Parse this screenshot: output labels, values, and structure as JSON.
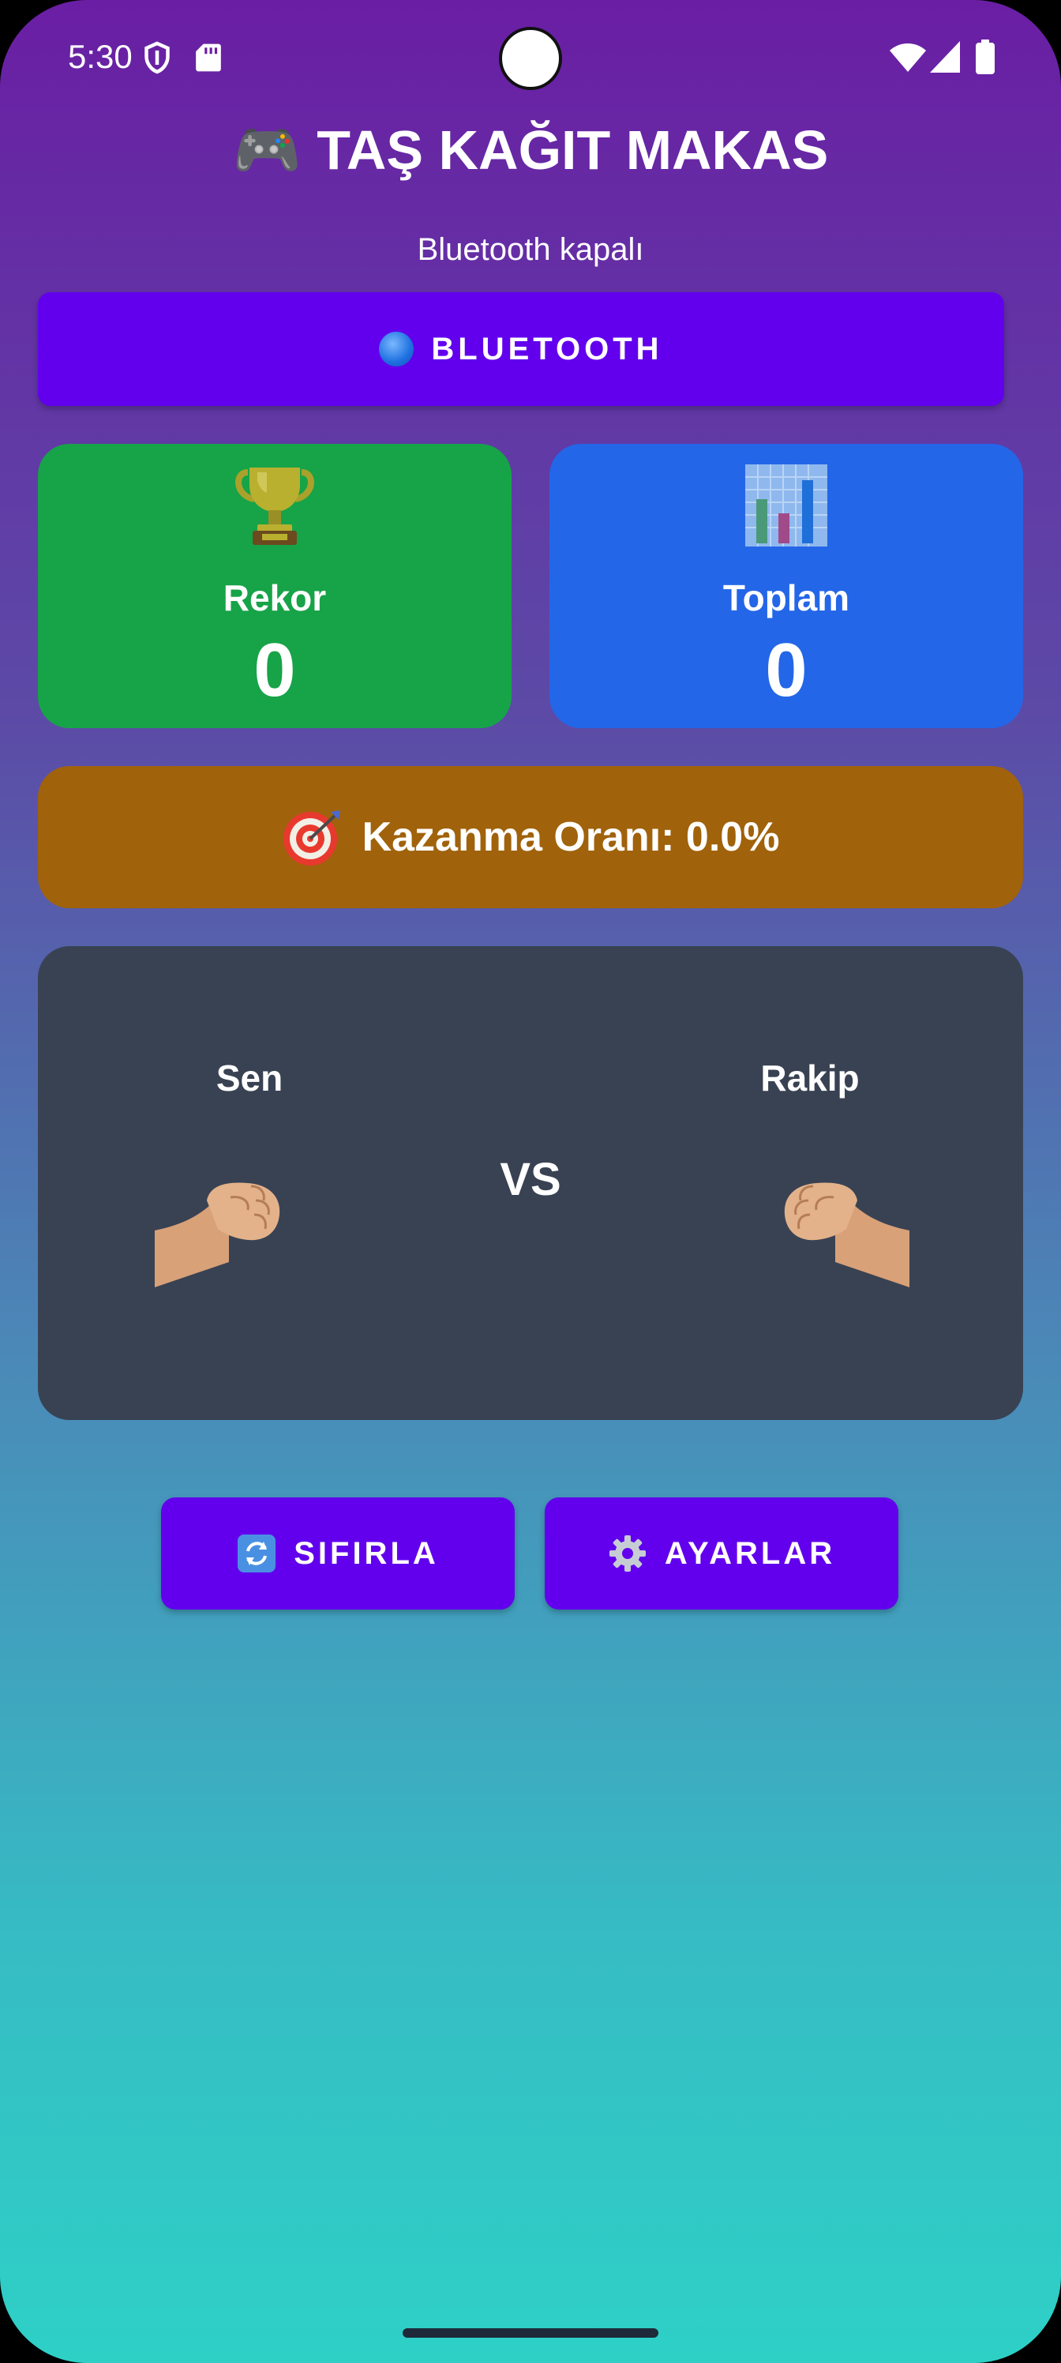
{
  "status_bar": {
    "time": "5:30",
    "icons": [
      "shield-icon",
      "sd-card-icon",
      "wifi-icon",
      "cell-signal-icon",
      "battery-icon"
    ]
  },
  "header": {
    "title": "🎮 TAŞ KAĞIT MAKAS",
    "bluetooth_status": "Bluetooth kapalı"
  },
  "bluetooth_button": {
    "label": "BLUETOOTH",
    "icon": "blue-circle-icon"
  },
  "stats": {
    "record": {
      "icon": "trophy-icon",
      "label": "Rekor",
      "value": "0"
    },
    "total": {
      "icon": "bar-chart-icon",
      "label": "Toplam",
      "value": "0"
    }
  },
  "win_rate": {
    "icon": "target-icon",
    "text": "Kazanma Oranı: 0.0%"
  },
  "battle": {
    "you_label": "Sen",
    "opponent_label": "Rakip",
    "vs_label": "VS",
    "you_hand": "fist-icon",
    "opponent_hand": "fist-icon"
  },
  "actions": {
    "reset_label": "SIFIRLA",
    "settings_label": "AYARLAR"
  },
  "colors": {
    "primary_button": "#6200ee",
    "record_card": "#17a348",
    "total_card": "#2466e8",
    "win_rate_card": "#a0620b",
    "battle_panel": "#394253",
    "gradient_top": "#6a1ea4",
    "gradient_bottom": "#2ed0c6"
  }
}
